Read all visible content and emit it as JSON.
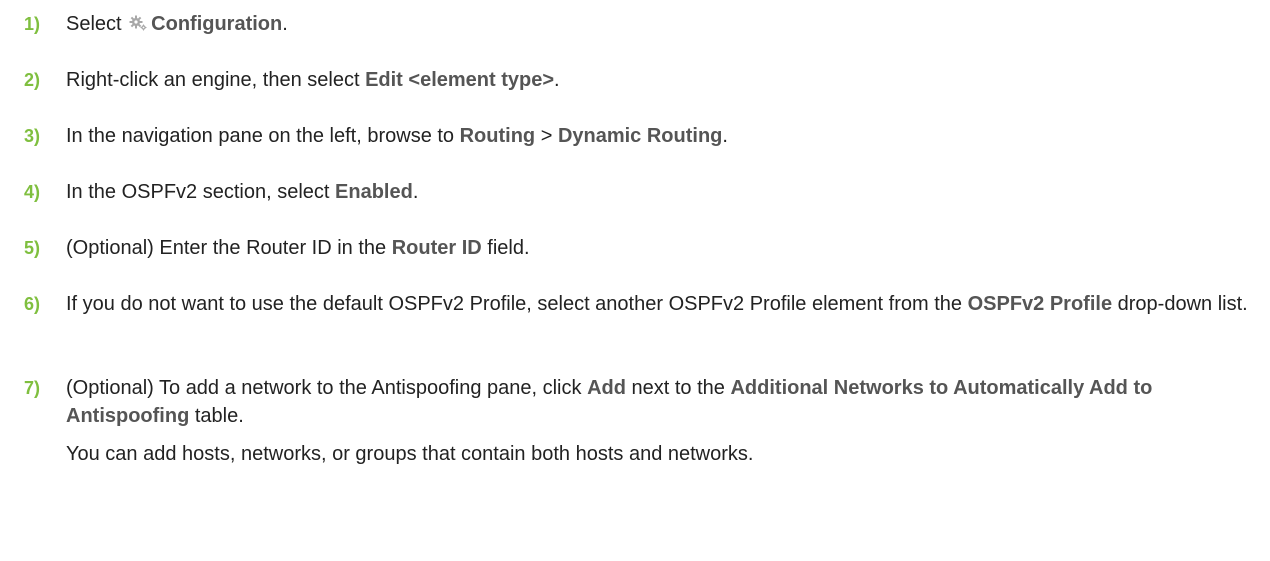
{
  "steps": [
    {
      "num": "1)",
      "pre": "Select ",
      "icon": "gear-icon",
      "bold": "Configuration",
      "post": "."
    },
    {
      "num": "2)",
      "pre": "Right-click an engine, then select ",
      "bold": "Edit <element type>",
      "post": "."
    },
    {
      "num": "3)",
      "pre": "In the navigation pane on the left, browse to ",
      "bold1": "Routing",
      "mid": " > ",
      "bold2": "Dynamic Routing",
      "post": "."
    },
    {
      "num": "4)",
      "pre": "In the OSPFv2 section, select ",
      "bold": "Enabled",
      "post": "."
    },
    {
      "num": "5)",
      "pre": "(Optional) Enter the Router ID in the ",
      "bold": "Router ID",
      "post": " field."
    },
    {
      "num": "6)",
      "pre": "If you do not want to use the default OSPFv2 Profile, select another OSPFv2 Profile element from the ",
      "bold": "OSPFv2 Profile",
      "post": " drop-down list."
    },
    {
      "num": "7)",
      "pre": "(Optional) To add a network to the Antispoofing pane, click ",
      "bold1": "Add",
      "mid": " next to the ",
      "bold2": "Additional Networks to Automatically Add to Antispoofing",
      "post": " table.",
      "note": "You can add hosts, networks, or groups that contain both hosts and networks."
    }
  ]
}
